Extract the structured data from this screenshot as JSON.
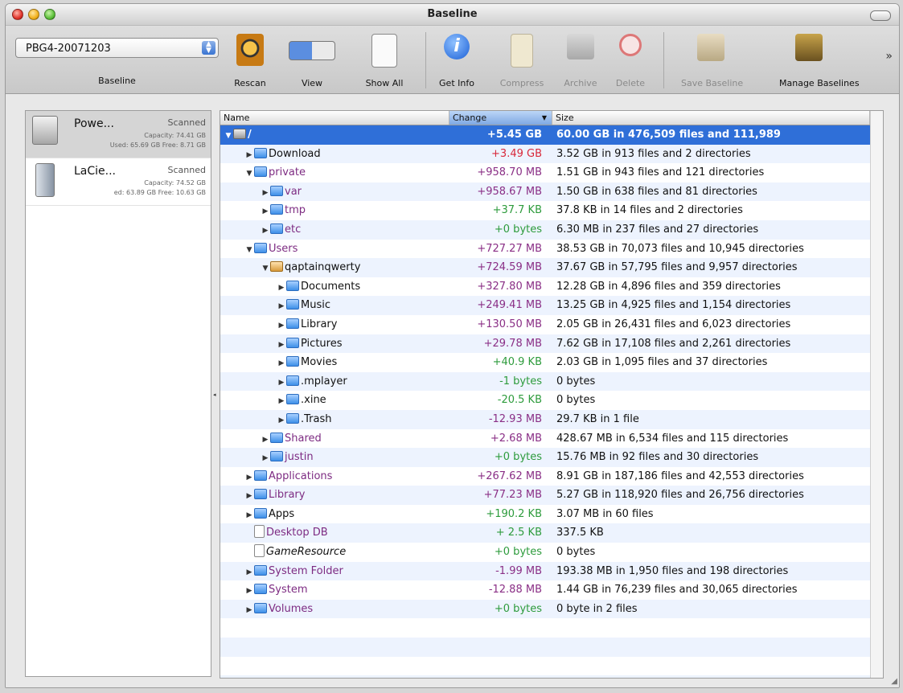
{
  "window": {
    "title": "Baseline"
  },
  "toolbar": {
    "baseline_value": "PBG4-20071203",
    "baseline_label": "Baseline",
    "rescan": "Rescan",
    "view": "View",
    "show_all": "Show All",
    "get_info": "Get Info",
    "compress": "Compress",
    "archive": "Archive",
    "delete": "Delete",
    "save_baseline": "Save Baseline",
    "manage_baselines": "Manage Baselines",
    "overflow": "»"
  },
  "devices": [
    {
      "name": "Powe...",
      "status": "Scanned",
      "capacity": "Capacity: 74.41 GB",
      "used": "Used: 65.69 GB Free: 8.71 GB"
    },
    {
      "name": "LaCie...",
      "status": "Scanned",
      "capacity": "Capacity: 74.52 GB",
      "used": "ed: 63.89 GB Free: 10.63 GB"
    }
  ],
  "table": {
    "col_name": "Name",
    "col_change": "Change",
    "col_size": "Size",
    "rows": [
      {
        "name": "/",
        "change": "+5.45 GB",
        "size": "60.00 GB in 476,509 files and 111,989"
      },
      {
        "name": "Download",
        "change": "+3.49 GB",
        "size": "3.52 GB in 913 files and 2 directories"
      },
      {
        "name": "private",
        "change": "+958.70 MB",
        "size": "1.51 GB in 943 files and 121 directories"
      },
      {
        "name": "var",
        "change": "+958.67 MB",
        "size": "1.50 GB in 638 files and 81 directories"
      },
      {
        "name": "tmp",
        "change": "+37.7 KB",
        "size": "37.8 KB in 14 files and 2 directories"
      },
      {
        "name": "etc",
        "change": "+0 bytes",
        "size": "6.30 MB in 237 files and 27 directories"
      },
      {
        "name": "Users",
        "change": "+727.27 MB",
        "size": "38.53 GB in 70,073 files and 10,945 directories"
      },
      {
        "name": "qaptainqwerty",
        "change": "+724.59 MB",
        "size": "37.67 GB in 57,795 files and 9,957 directories"
      },
      {
        "name": "Documents",
        "change": "+327.80 MB",
        "size": "12.28 GB in 4,896 files and 359 directories"
      },
      {
        "name": "Music",
        "change": "+249.41 MB",
        "size": "13.25 GB in 4,925 files and 1,154 directories"
      },
      {
        "name": "Library",
        "change": "+130.50 MB",
        "size": "2.05 GB in 26,431 files and 6,023 directories"
      },
      {
        "name": "Pictures",
        "change": "+29.78 MB",
        "size": "7.62 GB in 17,108 files and 2,261 directories"
      },
      {
        "name": "Movies",
        "change": "+40.9 KB",
        "size": "2.03 GB in 1,095 files and 37 directories"
      },
      {
        "name": ".mplayer",
        "change": "-1 bytes",
        "size": "0 bytes"
      },
      {
        "name": ".xine",
        "change": "-20.5 KB",
        "size": "0 bytes"
      },
      {
        "name": ".Trash",
        "change": "-12.93 MB",
        "size": "29.7 KB in 1 file"
      },
      {
        "name": "Shared",
        "change": "+2.68 MB",
        "size": "428.67 MB in 6,534 files and 115 directories"
      },
      {
        "name": "justin",
        "change": "+0 bytes",
        "size": "15.76 MB in 92 files and 30 directories"
      },
      {
        "name": "Applications",
        "change": "+267.62 MB",
        "size": "8.91 GB in 187,186 files and 42,553 directories"
      },
      {
        "name": "Library",
        "change": "+77.23 MB",
        "size": "5.27 GB in 118,920 files and 26,756 directories"
      },
      {
        "name": "Apps",
        "change": "+190.2 KB",
        "size": "3.07 MB in 60 files"
      },
      {
        "name": "Desktop DB",
        "change": "+ 2.5 KB",
        "size": "337.5 KB"
      },
      {
        "name": "GameResource",
        "change": "+0 bytes",
        "size": "0 bytes"
      },
      {
        "name": "System Folder",
        "change": "-1.99 MB",
        "size": "193.38 MB in 1,950 files and 198 directories"
      },
      {
        "name": "System",
        "change": "-12.88 MB",
        "size": "1.44 GB in 76,239 files and 30,065 directories"
      },
      {
        "name": "Volumes",
        "change": "+0 bytes",
        "size": "0 byte in 2 files"
      }
    ]
  },
  "colors": {
    "selection": "#2f6fd8",
    "increase": "#d8283a",
    "neutral": "#2d9b3c",
    "decrease": "#8a2f86"
  }
}
